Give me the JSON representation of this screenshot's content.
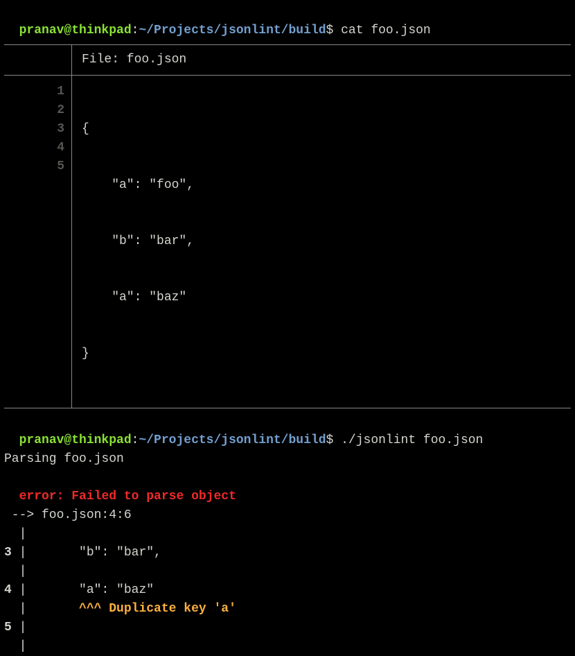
{
  "prompt1": {
    "user_host": "pranav@thinkpad",
    "colon": ":",
    "path": "~/Projects/jsonlint/build",
    "dollar": "$",
    "command": " cat foo.json"
  },
  "file_header": "File: foo.json",
  "gutter_lines": [
    "1",
    "2",
    "3",
    "4",
    "5"
  ],
  "code_lines": [
    "{",
    "    \"a\": \"foo\",",
    "    \"b\": \"bar\",",
    "    \"a\": \"baz\"",
    "}"
  ],
  "prompt2": {
    "user_host": "pranav@thinkpad",
    "colon": ":",
    "path": "~/Projects/jsonlint/build",
    "dollar": "$",
    "command": " ./jsonlint foo.json"
  },
  "parsing": "Parsing foo.json",
  "error_label": "error: ",
  "error_message": "Failed to parse object",
  "location": " --> foo.json:4:6",
  "ctx": {
    "pipe1": "  |",
    "line3": {
      "num": "3 ",
      "pipe": "|",
      "code": "       \"b\": \"bar\","
    },
    "pipe2": "  |",
    "line4": {
      "num": "4 ",
      "pipe": "|",
      "code": "       \"a\": \"baz\""
    },
    "caret": {
      "prefix": "  |       ",
      "marks": "^^^ ",
      "msg": "Duplicate key 'a'"
    },
    "line5": {
      "num": "5 ",
      "pipe": "|"
    },
    "pipe3": "  |"
  }
}
